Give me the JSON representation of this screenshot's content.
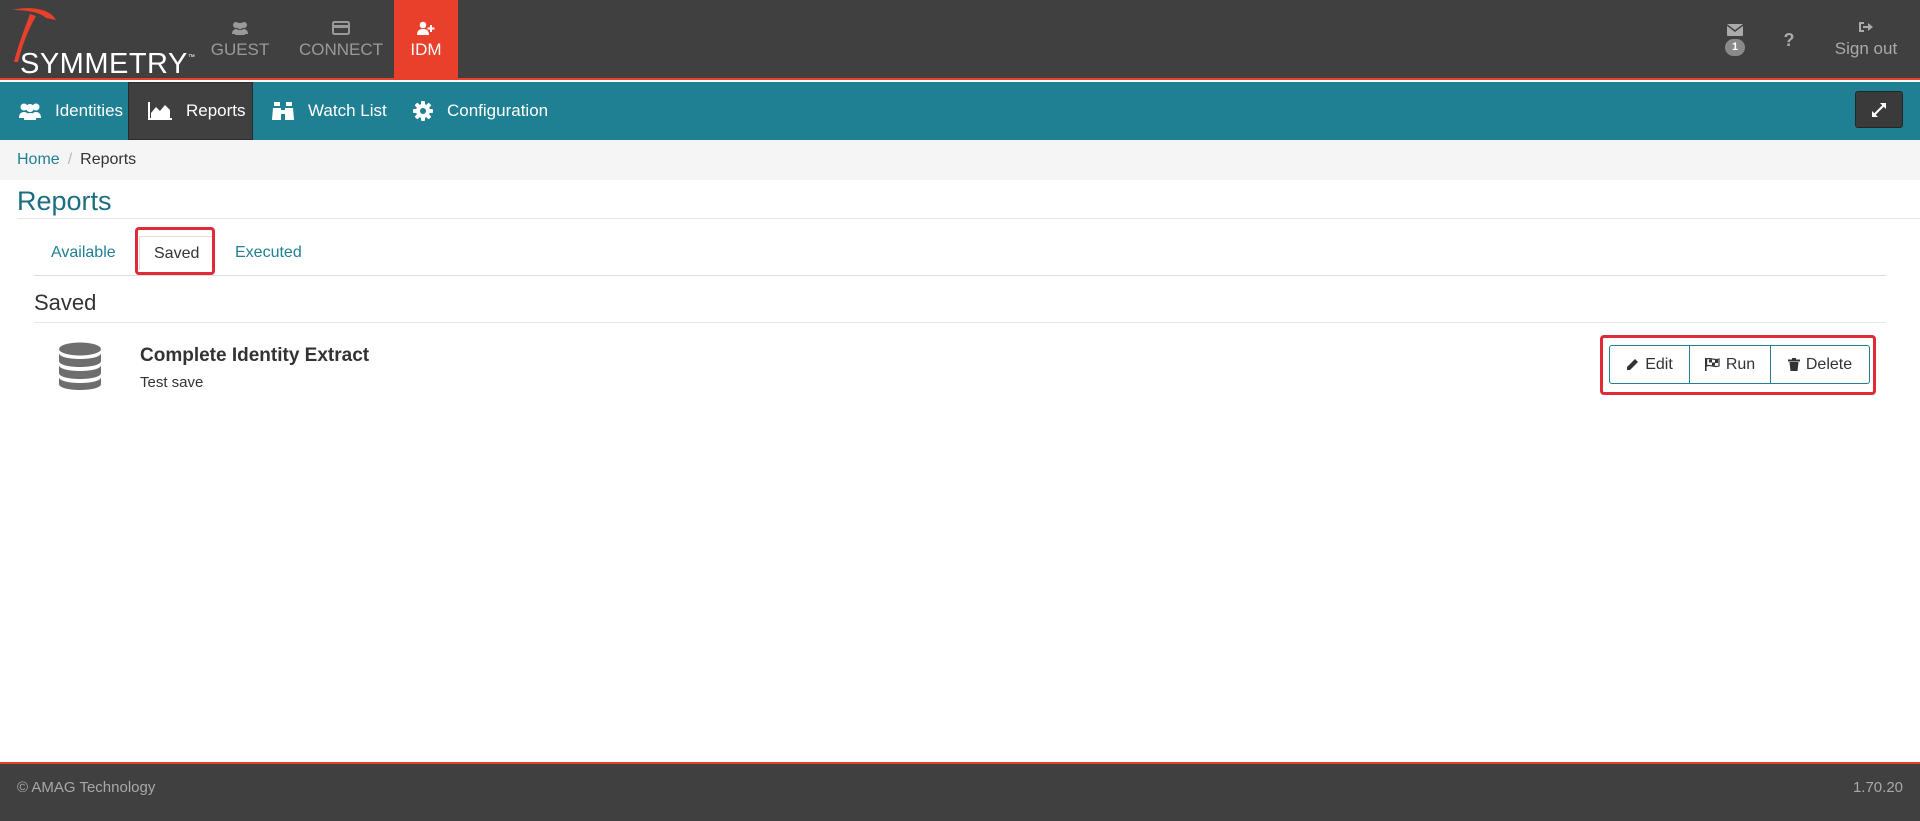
{
  "brand": {
    "logo_text": "SYMMETRY",
    "tm": "™",
    "accent": "#e8402b",
    "teal": "#1f7f93"
  },
  "appnav": {
    "guest": {
      "label": "GUEST",
      "icon": "users-icon"
    },
    "connect": {
      "label": "CONNECT",
      "icon": "card-icon"
    },
    "idm": {
      "label": "IDM",
      "icon": "user-plus-icon"
    }
  },
  "tools": {
    "mail_count": "1",
    "help_label": "?",
    "signout_label": "Sign out"
  },
  "modules": {
    "identities": "Identities",
    "reports": "Reports",
    "watchlist": "Watch List",
    "configuration": "Configuration"
  },
  "breadcrumb": {
    "home": "Home",
    "sep": "/",
    "current": "Reports"
  },
  "page": {
    "title": "Reports"
  },
  "tabs": {
    "available": "Available",
    "saved": "Saved",
    "executed": "Executed"
  },
  "section": {
    "title": "Saved"
  },
  "report": {
    "name": "Complete Identity Extract",
    "description": "Test save"
  },
  "actions": {
    "edit": "Edit",
    "run": "Run",
    "delete": "Delete"
  },
  "footer": {
    "copyright": "© AMAG Technology",
    "version": "1.70.20"
  }
}
